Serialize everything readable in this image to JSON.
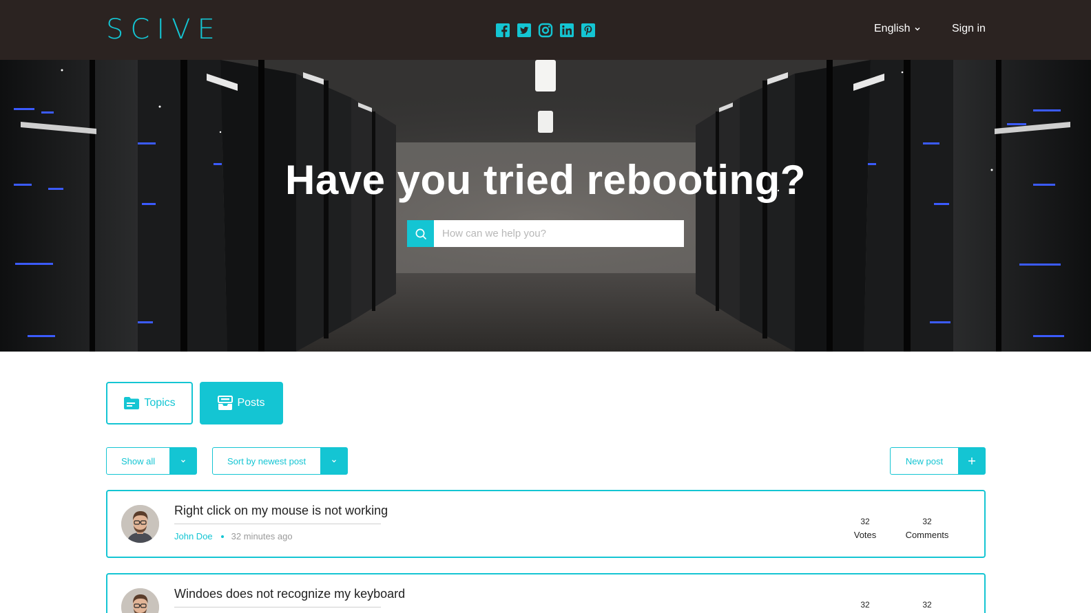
{
  "header": {
    "logo": "SCIVE",
    "social_icons": [
      "facebook-icon",
      "twitter-icon",
      "instagram-icon",
      "linkedin-icon",
      "pinterest-icon"
    ],
    "language": "English",
    "sign_in": "Sign in"
  },
  "hero": {
    "title": "Have you tried rebooting?",
    "search_placeholder": "How can we help you?"
  },
  "tabs": {
    "topics": "Topics",
    "posts": "Posts",
    "active": "Posts"
  },
  "filters": {
    "show": "Show all",
    "sort": "Sort by newest post",
    "new_post": "New post"
  },
  "posts": [
    {
      "title": "Right click on my mouse is not working",
      "author": "John Doe",
      "time": "32 minutes ago",
      "votes": "32",
      "votes_label": "Votes",
      "comments": "32",
      "comments_label": "Comments"
    },
    {
      "title": "Windoes does not recognize my keyboard",
      "votes": "32",
      "comments": "32"
    }
  ],
  "colors": {
    "accent": "#14c5d3",
    "header_bg": "#2b2321"
  }
}
